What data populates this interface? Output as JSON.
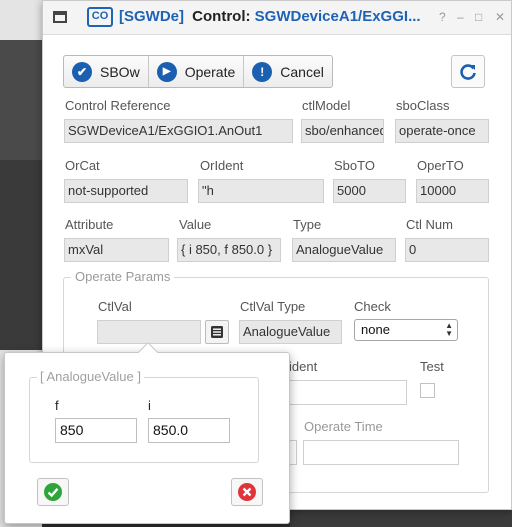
{
  "window": {
    "tag": "[SGWDe]",
    "label": "Control:",
    "reference": "SGWDeviceA1/ExGGI...",
    "help": "?",
    "minimize": "–",
    "maximize": "□",
    "close": "✕"
  },
  "toolbar": {
    "sbow_label": "SBOw",
    "operate_label": "Operate",
    "cancel_label": "Cancel"
  },
  "fields": {
    "control_reference": {
      "label": "Control Reference",
      "value": "SGWDeviceA1/ExGGIO1.AnOut1"
    },
    "ctl_model": {
      "label": "ctlModel",
      "value": "sbo/enhanced"
    },
    "sbo_class": {
      "label": "sboClass",
      "value": "operate-once"
    },
    "or_cat": {
      "label": "OrCat",
      "value": "not-supported"
    },
    "or_ident": {
      "label": "OrIdent",
      "value": "\"h"
    },
    "sbo_to": {
      "label": "SboTO",
      "value": "5000"
    },
    "oper_to": {
      "label": "OperTO",
      "value": "10000"
    },
    "attribute": {
      "label": "Attribute",
      "value": "mxVal"
    },
    "value": {
      "label": "Value",
      "value": "{ i 850, f 850.0 }"
    },
    "type": {
      "label": "Type",
      "value": "AnalogueValue"
    },
    "ctl_num": {
      "label": "Ctl Num",
      "value": "0"
    }
  },
  "operate_params": {
    "legend": "Operate Params",
    "ctl_val_label": "CtlVal",
    "ctl_val_value": "",
    "ctl_val_type_label": "CtlVal Type",
    "ctl_val_type_value": "AnalogueValue",
    "check_label": "Check",
    "check_value": "none",
    "orident_label": "ident",
    "test_label": "Test",
    "operate_time_label": "Operate Time"
  },
  "popup": {
    "legend": "[ AnalogueValue ]",
    "f_label": "f",
    "f_value": "850",
    "i_label": "i",
    "i_value": "850.0"
  },
  "colors": {
    "accent": "#1a5fb0",
    "cancel_red": "#e0343a",
    "ok_green": "#2ea43a"
  }
}
